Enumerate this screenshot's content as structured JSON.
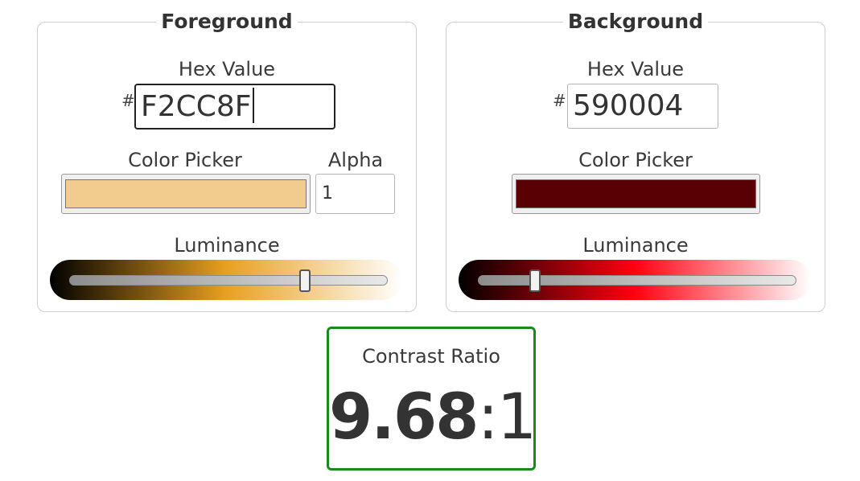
{
  "foreground": {
    "title": "Foreground",
    "hex_label": "Hex Value",
    "hash": "#",
    "hex_value": "F2CC8F",
    "picker_label": "Color Picker",
    "picker_color": "#F2CC8F",
    "alpha_label": "Alpha",
    "alpha_value": "1",
    "luminance_label": "Luminance",
    "luminance_level": 0.74,
    "gradient_colors": [
      "#000000",
      "#E8A020",
      "#FFFFFF"
    ]
  },
  "background": {
    "title": "Background",
    "hex_label": "Hex Value",
    "hash": "#",
    "hex_value": "590004",
    "picker_label": "Color Picker",
    "picker_color": "#590004",
    "luminance_label": "Luminance",
    "luminance_level": 0.18,
    "gradient_colors": [
      "#000000",
      "#FF0010",
      "#FFFFFF"
    ]
  },
  "contrast": {
    "label": "Contrast Ratio",
    "value": "9.68",
    "separator": ":",
    "denominator": "1",
    "status_color": "#1A8A1A"
  }
}
